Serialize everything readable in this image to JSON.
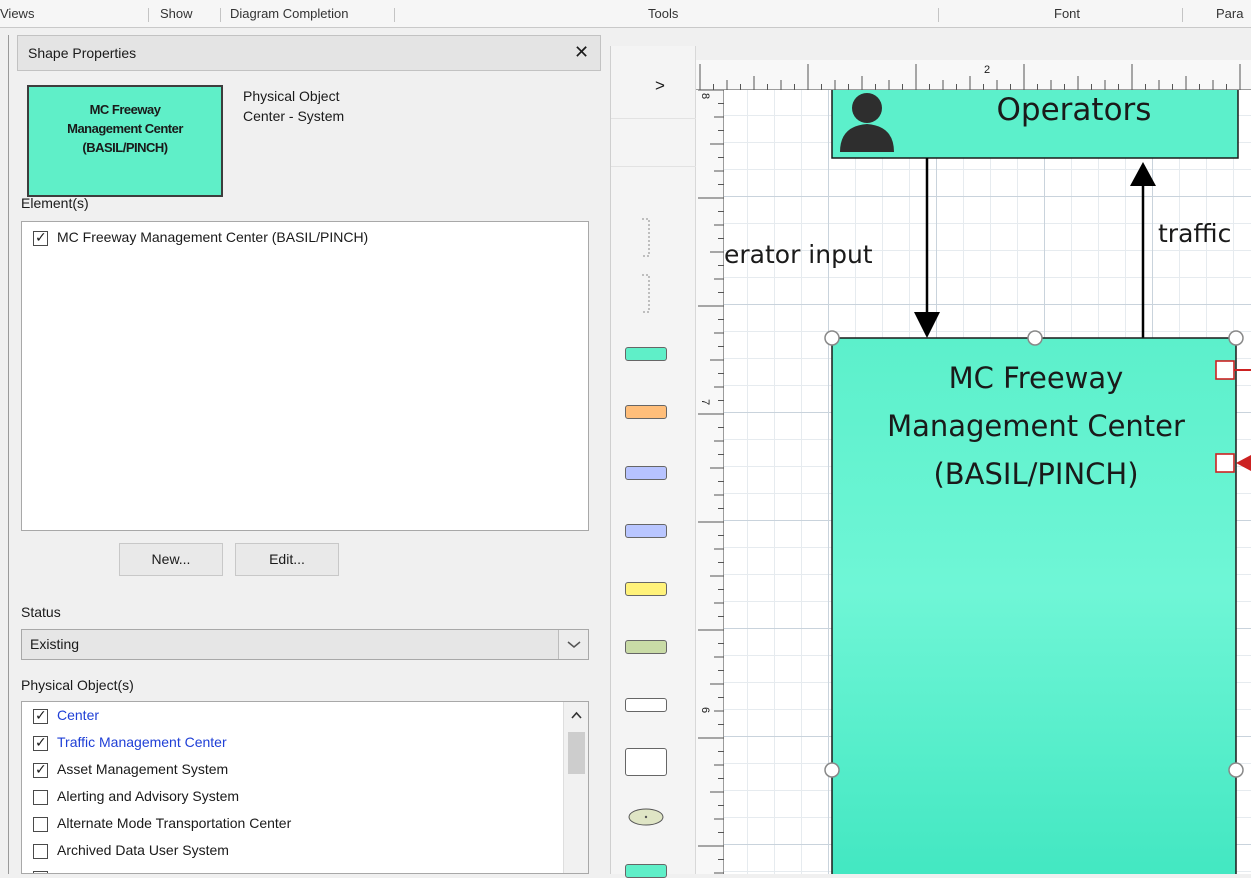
{
  "ribbon": {
    "groups": [
      "Views",
      "Show",
      "Diagram Completion",
      "Tools",
      "Font",
      "Para"
    ]
  },
  "panel": {
    "title": "Shape Properties",
    "close_glyph": "✕",
    "shape_preview": {
      "line1": "MC Freeway",
      "line2": "Management Center",
      "line3": "(BASIL/PINCH)"
    },
    "shape_type_line1": "Physical Object",
    "shape_type_line2": "Center - System",
    "elements_label": "Element(s)",
    "elements": [
      {
        "label": "MC Freeway Management Center (BASIL/PINCH)",
        "checked": true
      }
    ],
    "new_button": "New...",
    "edit_button": "Edit...",
    "status_label": "Status",
    "status_value": "Existing",
    "physical_objects_label": "Physical Object(s)",
    "physical_objects": [
      {
        "label": "Center",
        "checked": true,
        "link": true
      },
      {
        "label": "Traffic Management Center",
        "checked": true,
        "link": true
      },
      {
        "label": "Asset Management System",
        "checked": true,
        "link": false
      },
      {
        "label": "Alerting and Advisory System",
        "checked": false,
        "link": false
      },
      {
        "label": "Alternate Mode Transportation Center",
        "checked": false,
        "link": false
      },
      {
        "label": "Archived Data User System",
        "checked": false,
        "link": false
      }
    ]
  },
  "stencil": {
    "expand_glyph": ">",
    "swatch_colors": [
      "#5fefc8",
      "#ffbe7a",
      "#b7c3ff",
      "#b9c6ff",
      "#fff27a",
      "#c9dba6",
      "#ffffff",
      "#ffffff",
      "#dfe5c5",
      "#5fefc8"
    ]
  },
  "ruler": {
    "top_label": "2",
    "left_labels": [
      "8",
      "7",
      "6"
    ]
  },
  "diagram": {
    "operators_label": "Operators",
    "mc_line1": "MC Freeway",
    "mc_line2": "Management Center",
    "mc_line3": "(BASIL/PINCH)",
    "flow_left_label": "erator input",
    "flow_right_label": "traffic",
    "colors": {
      "box_fill": "#5cf0cb",
      "flow_port": "#cc2222"
    }
  }
}
